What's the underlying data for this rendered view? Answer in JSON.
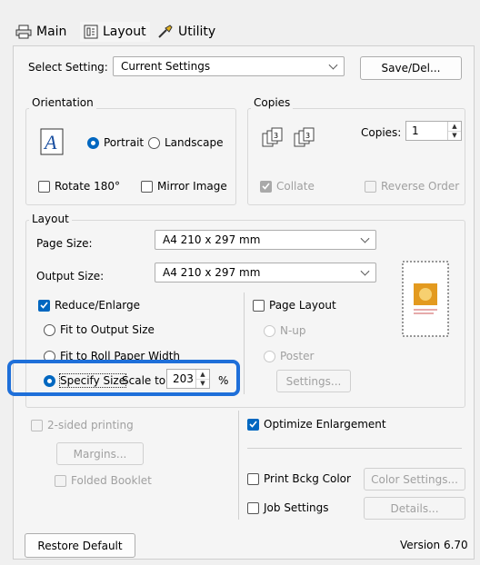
{
  "tabs": [
    {
      "label": "Main",
      "icon": "printer-icon"
    },
    {
      "label": "Layout",
      "icon": "layout-icon"
    },
    {
      "label": "Utility",
      "icon": "wrench-icon"
    }
  ],
  "select_setting": {
    "label": "Select Setting:",
    "value": "Current Settings",
    "save_label": "Save/Del..."
  },
  "orientation": {
    "title": "Orientation",
    "portrait": "Portrait",
    "landscape": "Landscape",
    "rotate": "Rotate 180°",
    "mirror": "Mirror Image"
  },
  "copies": {
    "title": "Copies",
    "label": "Copies:",
    "value": "1",
    "collate": "Collate",
    "reverse": "Reverse Order"
  },
  "layout": {
    "title": "Layout",
    "page_size_label": "Page Size:",
    "page_size_value": "A4 210 x 297 mm",
    "output_size_label": "Output Size:",
    "output_size_value": "A4 210 x 297 mm",
    "reduce_enlarge": "Reduce/Enlarge",
    "fit_output": "Fit to Output Size",
    "fit_roll": "Fit to Roll Paper Width",
    "specify_size": "Specify Size",
    "scale_to": "Scale to",
    "scale_value": "203",
    "percent": "%",
    "page_layout": "Page Layout",
    "nup": "N-up",
    "poster": "Poster",
    "settings": "Settings..."
  },
  "two_sided": {
    "label": "2-sided printing",
    "margins": "Margins...",
    "folded": "Folded Booklet"
  },
  "optimize": "Optimize Enlargement",
  "print_bckg": {
    "label": "Print Bckg Color",
    "button": "Color Settings..."
  },
  "job_settings": {
    "label": "Job Settings",
    "button": "Details..."
  },
  "footer": {
    "restore": "Restore Default",
    "version": "Version 6.70"
  },
  "accent": "#0067c0",
  "highlight_color": "#1e6fd9"
}
